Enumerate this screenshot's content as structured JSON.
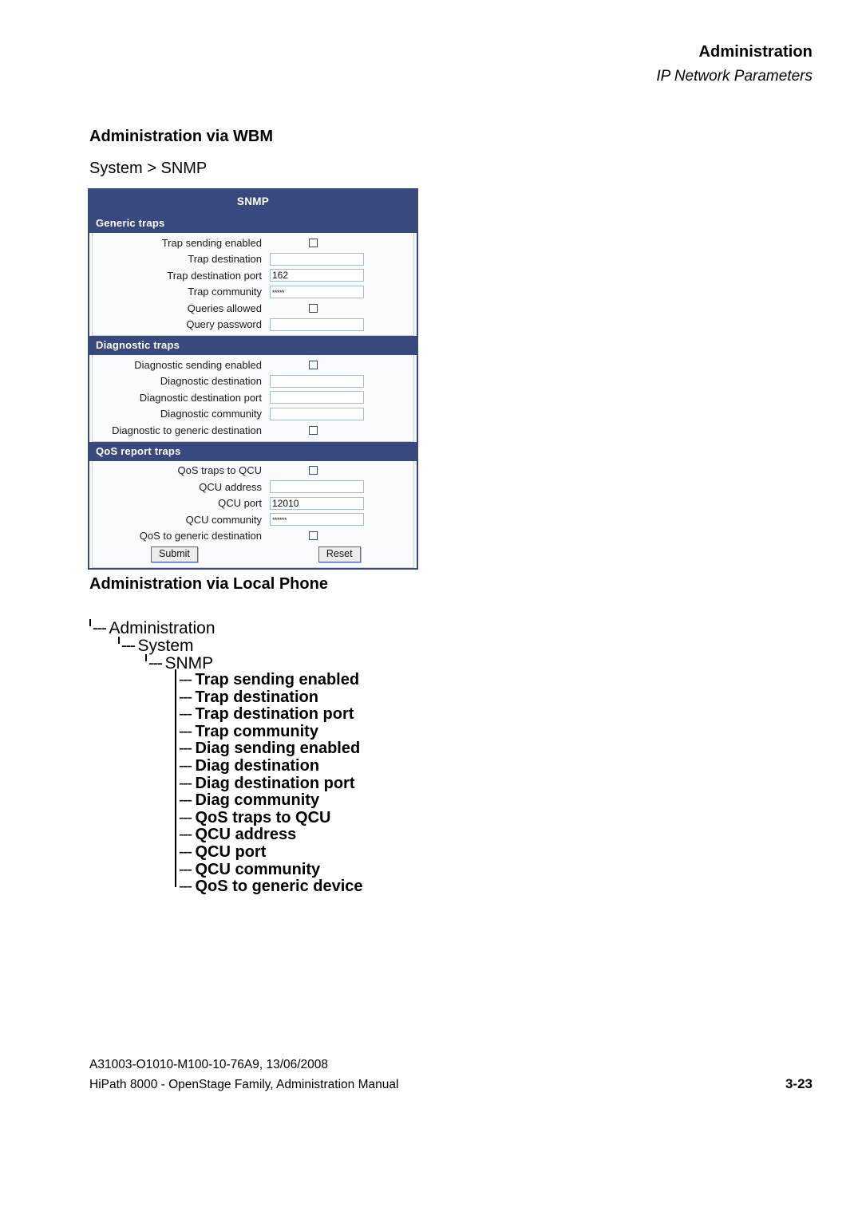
{
  "header": {
    "title": "Administration",
    "subtitle": "IP Network Parameters"
  },
  "sections": {
    "wbm_heading": "Administration via WBM",
    "breadcrumb": "System > SNMP",
    "phone_heading": "Administration via Local Phone"
  },
  "colors": {
    "panel_navy": "#38497e",
    "input_border": "#a3bcd6",
    "checkbox_border": "#2a4a8a",
    "page_background": "#ffffff"
  },
  "wbm_panel": {
    "title": "SNMP",
    "groups": [
      {
        "name": "Generic traps",
        "rows": [
          {
            "label": "Trap sending enabled",
            "type": "checkbox",
            "checked": false
          },
          {
            "label": "Trap destination",
            "type": "text",
            "value": ""
          },
          {
            "label": "Trap destination port",
            "type": "text",
            "value": "162"
          },
          {
            "label": "Trap community",
            "type": "password",
            "value": "*****"
          },
          {
            "label": "Queries allowed",
            "type": "checkbox",
            "checked": false
          },
          {
            "label": "Query password",
            "type": "text",
            "value": ""
          }
        ]
      },
      {
        "name": "Diagnostic traps",
        "rows": [
          {
            "label": "Diagnostic sending enabled",
            "type": "checkbox",
            "checked": false
          },
          {
            "label": "Diagnostic destination",
            "type": "text",
            "value": ""
          },
          {
            "label": "Diagnostic destination port",
            "type": "text",
            "value": ""
          },
          {
            "label": "Diagnostic community",
            "type": "text",
            "value": ""
          },
          {
            "label": "Diagnostic to generic destination",
            "type": "checkbox",
            "checked": false
          }
        ]
      },
      {
        "name": "QoS report traps",
        "rows": [
          {
            "label": "QoS traps to QCU",
            "type": "checkbox",
            "checked": false
          },
          {
            "label": "QCU address",
            "type": "text",
            "value": ""
          },
          {
            "label": "QCU port",
            "type": "text",
            "value": "12010"
          },
          {
            "label": "QCU community",
            "type": "password",
            "value": "******"
          },
          {
            "label": "QoS to generic destination",
            "type": "checkbox",
            "checked": false
          }
        ]
      }
    ],
    "buttons": {
      "submit": "Submit",
      "reset": "Reset"
    }
  },
  "phone_tree": {
    "branches": [
      {
        "label": "Administration",
        "level": 1
      },
      {
        "label": "System",
        "level": 2
      },
      {
        "label": "SNMP",
        "level": 3
      }
    ],
    "leaves": [
      "Trap sending enabled",
      "Trap destination",
      "Trap destination port",
      "Trap community",
      "Diag sending enabled",
      "Diag destination",
      "Diag destination port",
      "Diag community",
      "QoS traps to QCU",
      "QCU address",
      "QCU port",
      "QCU community",
      "QoS to generic device"
    ]
  },
  "footer": {
    "doc_id": "A31003-O1010-M100-10-76A9, 13/06/2008",
    "manual": "HiPath 8000 - OpenStage Family, Administration Manual",
    "page_number": "3-23"
  }
}
